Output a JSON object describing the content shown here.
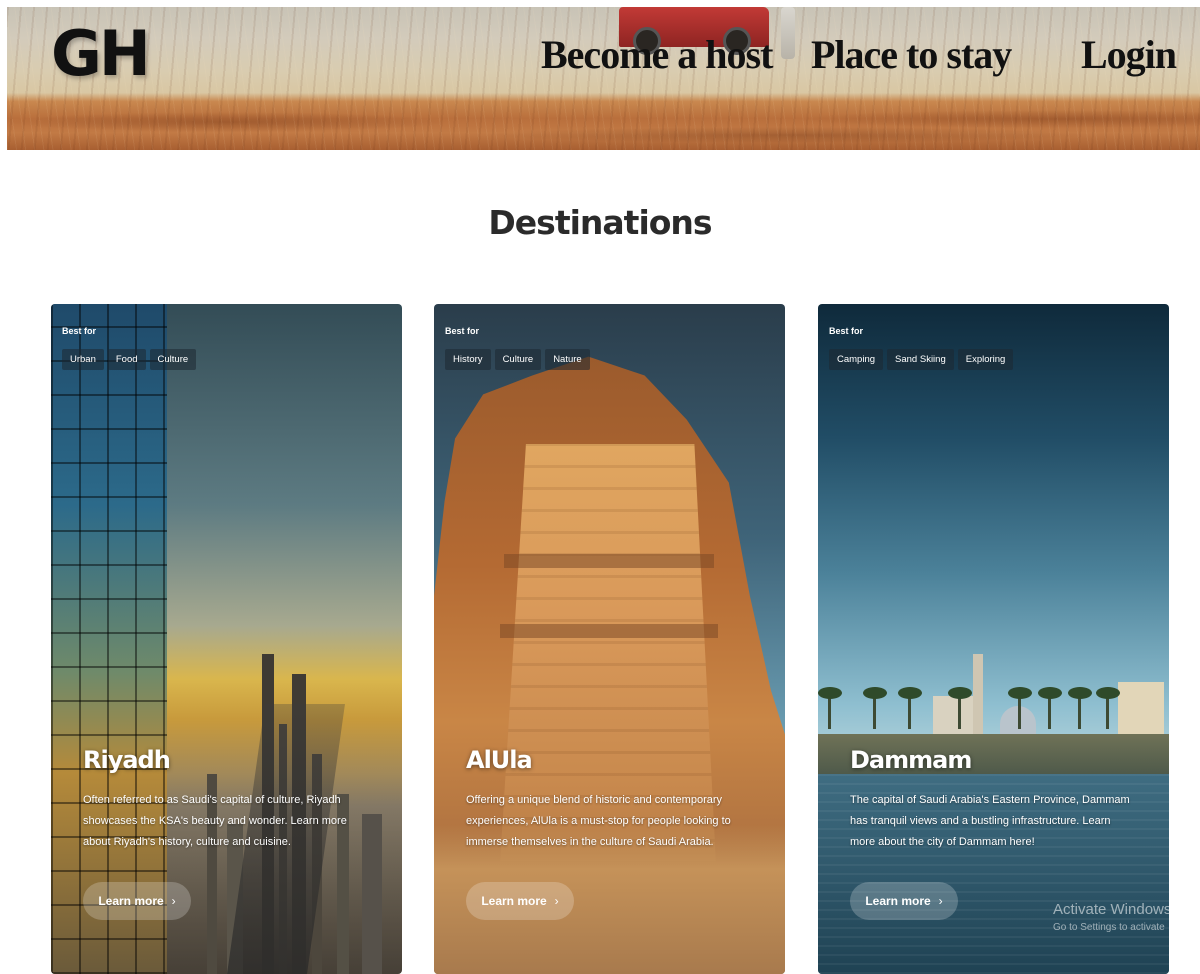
{
  "header": {
    "logo": "GH",
    "nav": {
      "become_host": "Become a host",
      "place_to_stay": "Place to stay",
      "login": "Login"
    }
  },
  "section": {
    "title": "Destinations"
  },
  "cards": [
    {
      "best_for_label": "Best for",
      "tags": [
        "Urban",
        "Food",
        "Culture"
      ],
      "title": "Riyadh",
      "description": "Often referred to as Saudi's capital of culture, Riyadh showcases the KSA's beauty and wonder. Learn more about Riyadh's history, culture and cuisine.",
      "button_label": "Learn more"
    },
    {
      "best_for_label": "Best for",
      "tags": [
        "History",
        "Culture",
        "Nature"
      ],
      "title": "AlUla",
      "description": "Offering a unique blend of historic and contemporary experiences, AlUla is a must-stop for people looking to immerse themselves in the culture of Saudi Arabia.",
      "button_label": "Learn more"
    },
    {
      "best_for_label": "Best for",
      "tags": [
        "Camping",
        "Sand Skiing",
        "Exploring"
      ],
      "title": "Dammam",
      "description": "The capital of Saudi Arabia's Eastern Province, Dammam has tranquil views and a bustling infrastructure. Learn more about the city of Dammam here!",
      "button_label": "Learn more"
    }
  ],
  "watermark": {
    "title": "Activate Windows",
    "subtitle": "Go to Settings to activate"
  },
  "icons": {
    "chevron": "chevron-right-icon"
  }
}
